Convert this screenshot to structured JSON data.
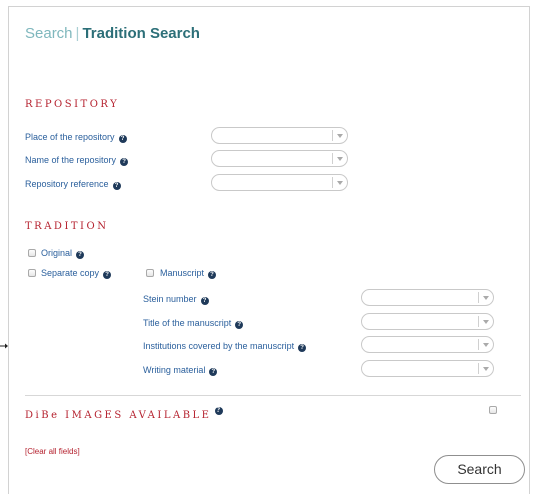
{
  "header": {
    "breadcrumb_root": "Search",
    "separator": "|",
    "current": "Tradition Search"
  },
  "repository": {
    "heading": "REPOSITORY",
    "fields": [
      {
        "label": "Place of the repository",
        "value": ""
      },
      {
        "label": "Name of the repository",
        "value": ""
      },
      {
        "label": "Repository reference",
        "value": ""
      }
    ]
  },
  "tradition": {
    "heading": "TRADITION",
    "original_label": "Original",
    "separate_copy_label": "Separate copy",
    "manuscript_label": "Manuscript",
    "manuscript_fields": [
      {
        "label": "Stein number",
        "value": ""
      },
      {
        "label": "Title of the manuscript",
        "value": ""
      },
      {
        "label": "Institutions covered by the manuscript",
        "value": ""
      },
      {
        "label": "Writing material",
        "value": ""
      }
    ]
  },
  "images": {
    "heading": "DiBe IMAGES AVAILABLE"
  },
  "footer": {
    "clear_label": "[Clear all fields]",
    "search_label": "Search"
  },
  "icons": {
    "help": "question-circle-icon",
    "dropdown": "chevron-down-icon",
    "pointer": "arrow-right-icon"
  },
  "colors": {
    "accent_red": "#b5222f",
    "label_blue": "#2a5f9c",
    "title_teal": "#2c6f78"
  }
}
